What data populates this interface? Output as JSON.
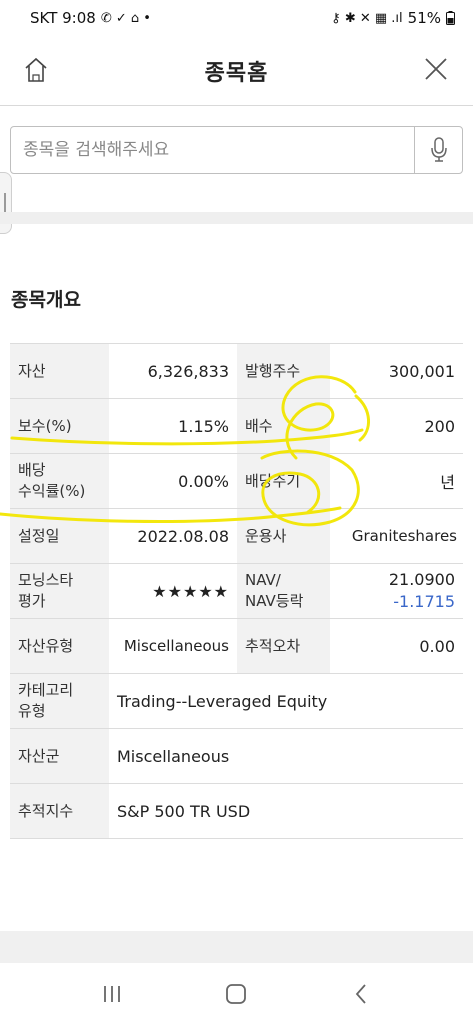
{
  "status_bar": {
    "carrier_time": "SKT 9:08",
    "left_icons": "✆ ✓ ⌂ •",
    "right_icons": "⚷ ✱ ✕ ▦ .ıl",
    "battery": "51%"
  },
  "header": {
    "title": "종목홈"
  },
  "search": {
    "placeholder": "종목을 검색해주세요"
  },
  "overview": {
    "title": "종목개요",
    "rows": [
      {
        "label": "자산",
        "value": "6,326,833",
        "label2": "발행주수",
        "value2": "300,001"
      },
      {
        "label": "보수(%)",
        "value": "1.15%",
        "label2": "배수",
        "value2": "200"
      },
      {
        "label": "배당\n수익률(%)",
        "value": "0.00%",
        "label2": "배당주기",
        "value2": "년"
      },
      {
        "label": "설정일",
        "value": "2022.08.08",
        "label2": "운용사",
        "value2": "Graniteshares"
      },
      {
        "label": "모닝스타\n평가",
        "value": "★★★★★",
        "label2": "NAV/\nNAV등락",
        "value2": "21.0900",
        "value2b": "-1.1715"
      },
      {
        "label": "자산유형",
        "value": "Miscellaneous",
        "label2": "추적오차",
        "value2": "0.00"
      }
    ],
    "wide_rows": [
      {
        "label": "카테고리\n유형",
        "value": "Trading--Leveraged Equity"
      },
      {
        "label": "자산군",
        "value": "Miscellaneous"
      },
      {
        "label": "추적지수",
        "value": "S&P 500 TR USD"
      }
    ]
  },
  "colors": {
    "accent_negative": "#3a67c9",
    "annotation": "#f2e600",
    "label_bg": "#f2f2f2"
  },
  "icons": [
    "home-icon",
    "close-icon",
    "microphone-icon",
    "recent-apps-icon",
    "home-nav-icon",
    "back-icon"
  ]
}
